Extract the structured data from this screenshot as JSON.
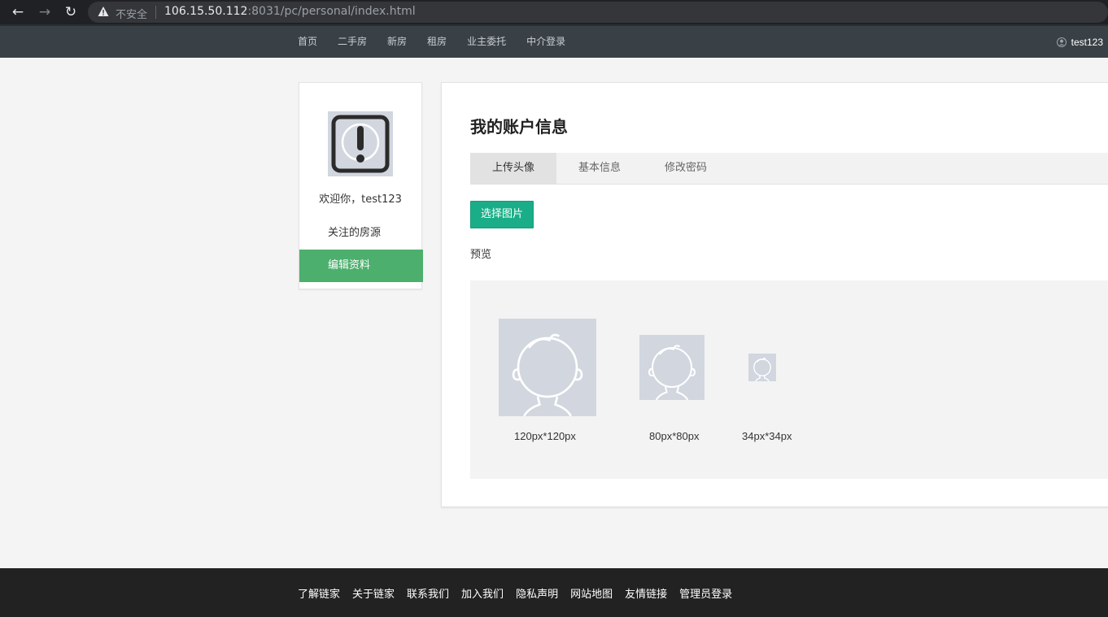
{
  "browser": {
    "back_icon": "arrow-left-icon",
    "forward_icon": "arrow-right-icon",
    "reload_icon": "reload-icon",
    "security_label": "不安全",
    "url_host": "106.15.50.112",
    "url_rest": ":8031/pc/personal/index.html"
  },
  "nav": {
    "links": [
      "首页",
      "二手房",
      "新房",
      "租房",
      "业主委托",
      "中介登录"
    ],
    "username": "test123"
  },
  "sidebar": {
    "welcome": "欢迎你，test123",
    "items": [
      "关注的房源",
      "编辑资料"
    ],
    "active_color": "#4caf6d"
  },
  "main": {
    "title": "我的账户信息",
    "tabs": [
      "上传头像",
      "基本信息",
      "修改密码"
    ],
    "choose_button": "选择图片",
    "preview_label": "预览",
    "previews": [
      "120px*120px",
      "80px*80px",
      "34px*34px"
    ],
    "accent_color": "#1aae88"
  },
  "footer": {
    "links": [
      "了解链家",
      "关于链家",
      "联系我们",
      "加入我们",
      "隐私声明",
      "网站地图",
      "友情链接",
      "管理员登录"
    ]
  }
}
